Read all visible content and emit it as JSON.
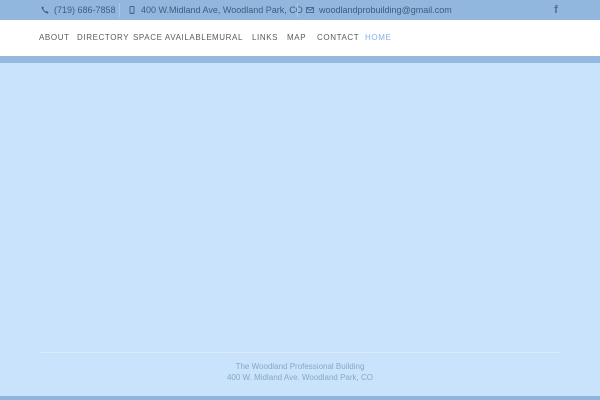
{
  "topbar": {
    "phone": "(719) 686-7858",
    "address": "400 W.Midland Ave, Woodland Park, CO",
    "email": "woodlandprobuilding@gmail.com",
    "social_icon": "facebook-icon"
  },
  "nav": {
    "items": [
      {
        "label": "ABOUT"
      },
      {
        "label": "DIRECTORY"
      },
      {
        "label": "SPACE AVAILABLE"
      },
      {
        "label": "MURAL"
      },
      {
        "label": "LINKS"
      },
      {
        "label": "MAP"
      },
      {
        "label": "CONTACT"
      },
      {
        "label": "HOME",
        "active": true
      }
    ]
  },
  "footer": {
    "line1": "The Woodland Professional Building",
    "line2": "400 W. Midland Ave. Woodland Park, CO"
  },
  "colors": {
    "topbar_bg": "#91b7de",
    "page_bg": "#c9e3fc",
    "active_link": "#7fb4e8"
  }
}
